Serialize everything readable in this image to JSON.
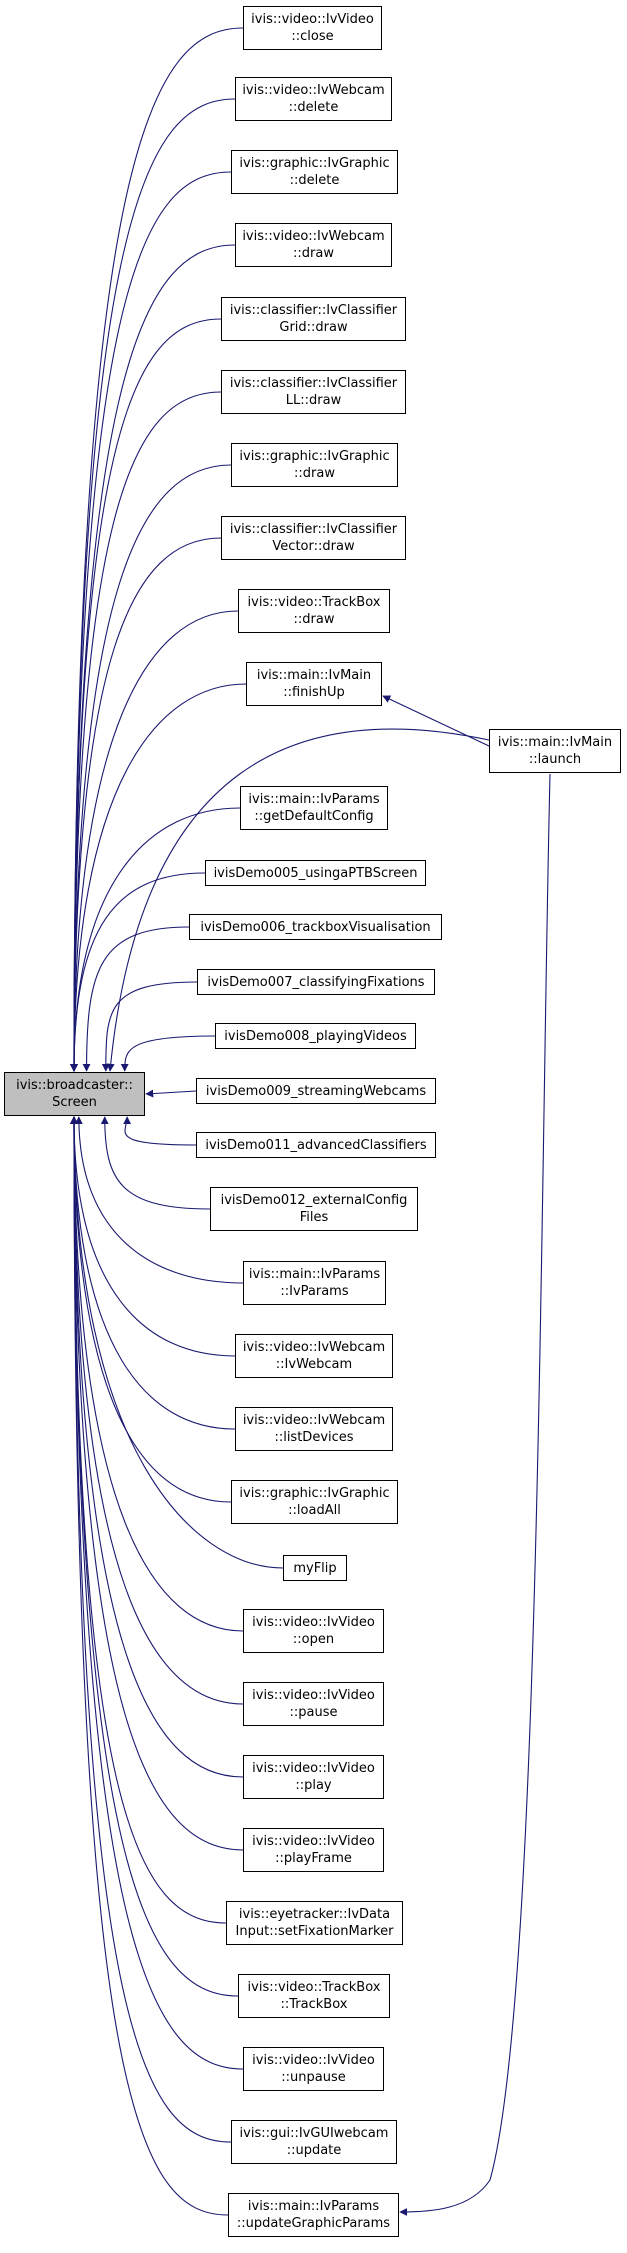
{
  "colors": {
    "edge": "#191970",
    "node_border": "#000000",
    "root_fill": "#bfbfbf"
  },
  "root": {
    "line1": "ivis::broadcaster::",
    "line2": "Screen"
  },
  "launcher": {
    "line1": "ivis::main::IvMain",
    "line2": "::launch"
  },
  "callers": [
    {
      "line1": "ivis::video::IvVideo",
      "line2": "::close"
    },
    {
      "line1": "ivis::video::IvWebcam",
      "line2": "::delete"
    },
    {
      "line1": "ivis::graphic::IvGraphic",
      "line2": "::delete"
    },
    {
      "line1": "ivis::video::IvWebcam",
      "line2": "::draw"
    },
    {
      "line1": "ivis::classifier::IvClassifier",
      "line2": "Grid::draw"
    },
    {
      "line1": "ivis::classifier::IvClassifier",
      "line2": "LL::draw"
    },
    {
      "line1": "ivis::graphic::IvGraphic",
      "line2": "::draw"
    },
    {
      "line1": "ivis::classifier::IvClassifier",
      "line2": "Vector::draw"
    },
    {
      "line1": "ivis::video::TrackBox",
      "line2": "::draw"
    },
    {
      "line1": "ivis::main::IvMain",
      "line2": "::finishUp"
    },
    {
      "line1": "ivis::main::IvParams",
      "line2": "::getDefaultConfig"
    },
    {
      "line1": "ivisDemo005_usingaPTBScreen",
      "line2": ""
    },
    {
      "line1": "ivisDemo006_trackboxVisualisation",
      "line2": ""
    },
    {
      "line1": "ivisDemo007_classifyingFixations",
      "line2": ""
    },
    {
      "line1": "ivisDemo008_playingVideos",
      "line2": ""
    },
    {
      "line1": "ivisDemo009_streamingWebcams",
      "line2": ""
    },
    {
      "line1": "ivisDemo011_advancedClassifiers",
      "line2": ""
    },
    {
      "line1": "ivisDemo012_externalConfig",
      "line2": "Files"
    },
    {
      "line1": "ivis::main::IvParams",
      "line2": "::IvParams"
    },
    {
      "line1": "ivis::video::IvWebcam",
      "line2": "::IvWebcam"
    },
    {
      "line1": "ivis::video::IvWebcam",
      "line2": "::listDevices"
    },
    {
      "line1": "ivis::graphic::IvGraphic",
      "line2": "::loadAll"
    },
    {
      "line1": "myFlip",
      "line2": ""
    },
    {
      "line1": "ivis::video::IvVideo",
      "line2": "::open"
    },
    {
      "line1": "ivis::video::IvVideo",
      "line2": "::pause"
    },
    {
      "line1": "ivis::video::IvVideo",
      "line2": "::play"
    },
    {
      "line1": "ivis::video::IvVideo",
      "line2": "::playFrame"
    },
    {
      "line1": "ivis::eyetracker::IvData",
      "line2": "Input::setFixationMarker"
    },
    {
      "line1": "ivis::video::TrackBox",
      "line2": "::TrackBox"
    },
    {
      "line1": "ivis::video::IvVideo",
      "line2": "::unpause"
    },
    {
      "line1": "ivis::gui::IvGUIwebcam",
      "line2": "::update"
    },
    {
      "line1": "ivis::main::IvParams",
      "line2": "::updateGraphicParams"
    }
  ]
}
